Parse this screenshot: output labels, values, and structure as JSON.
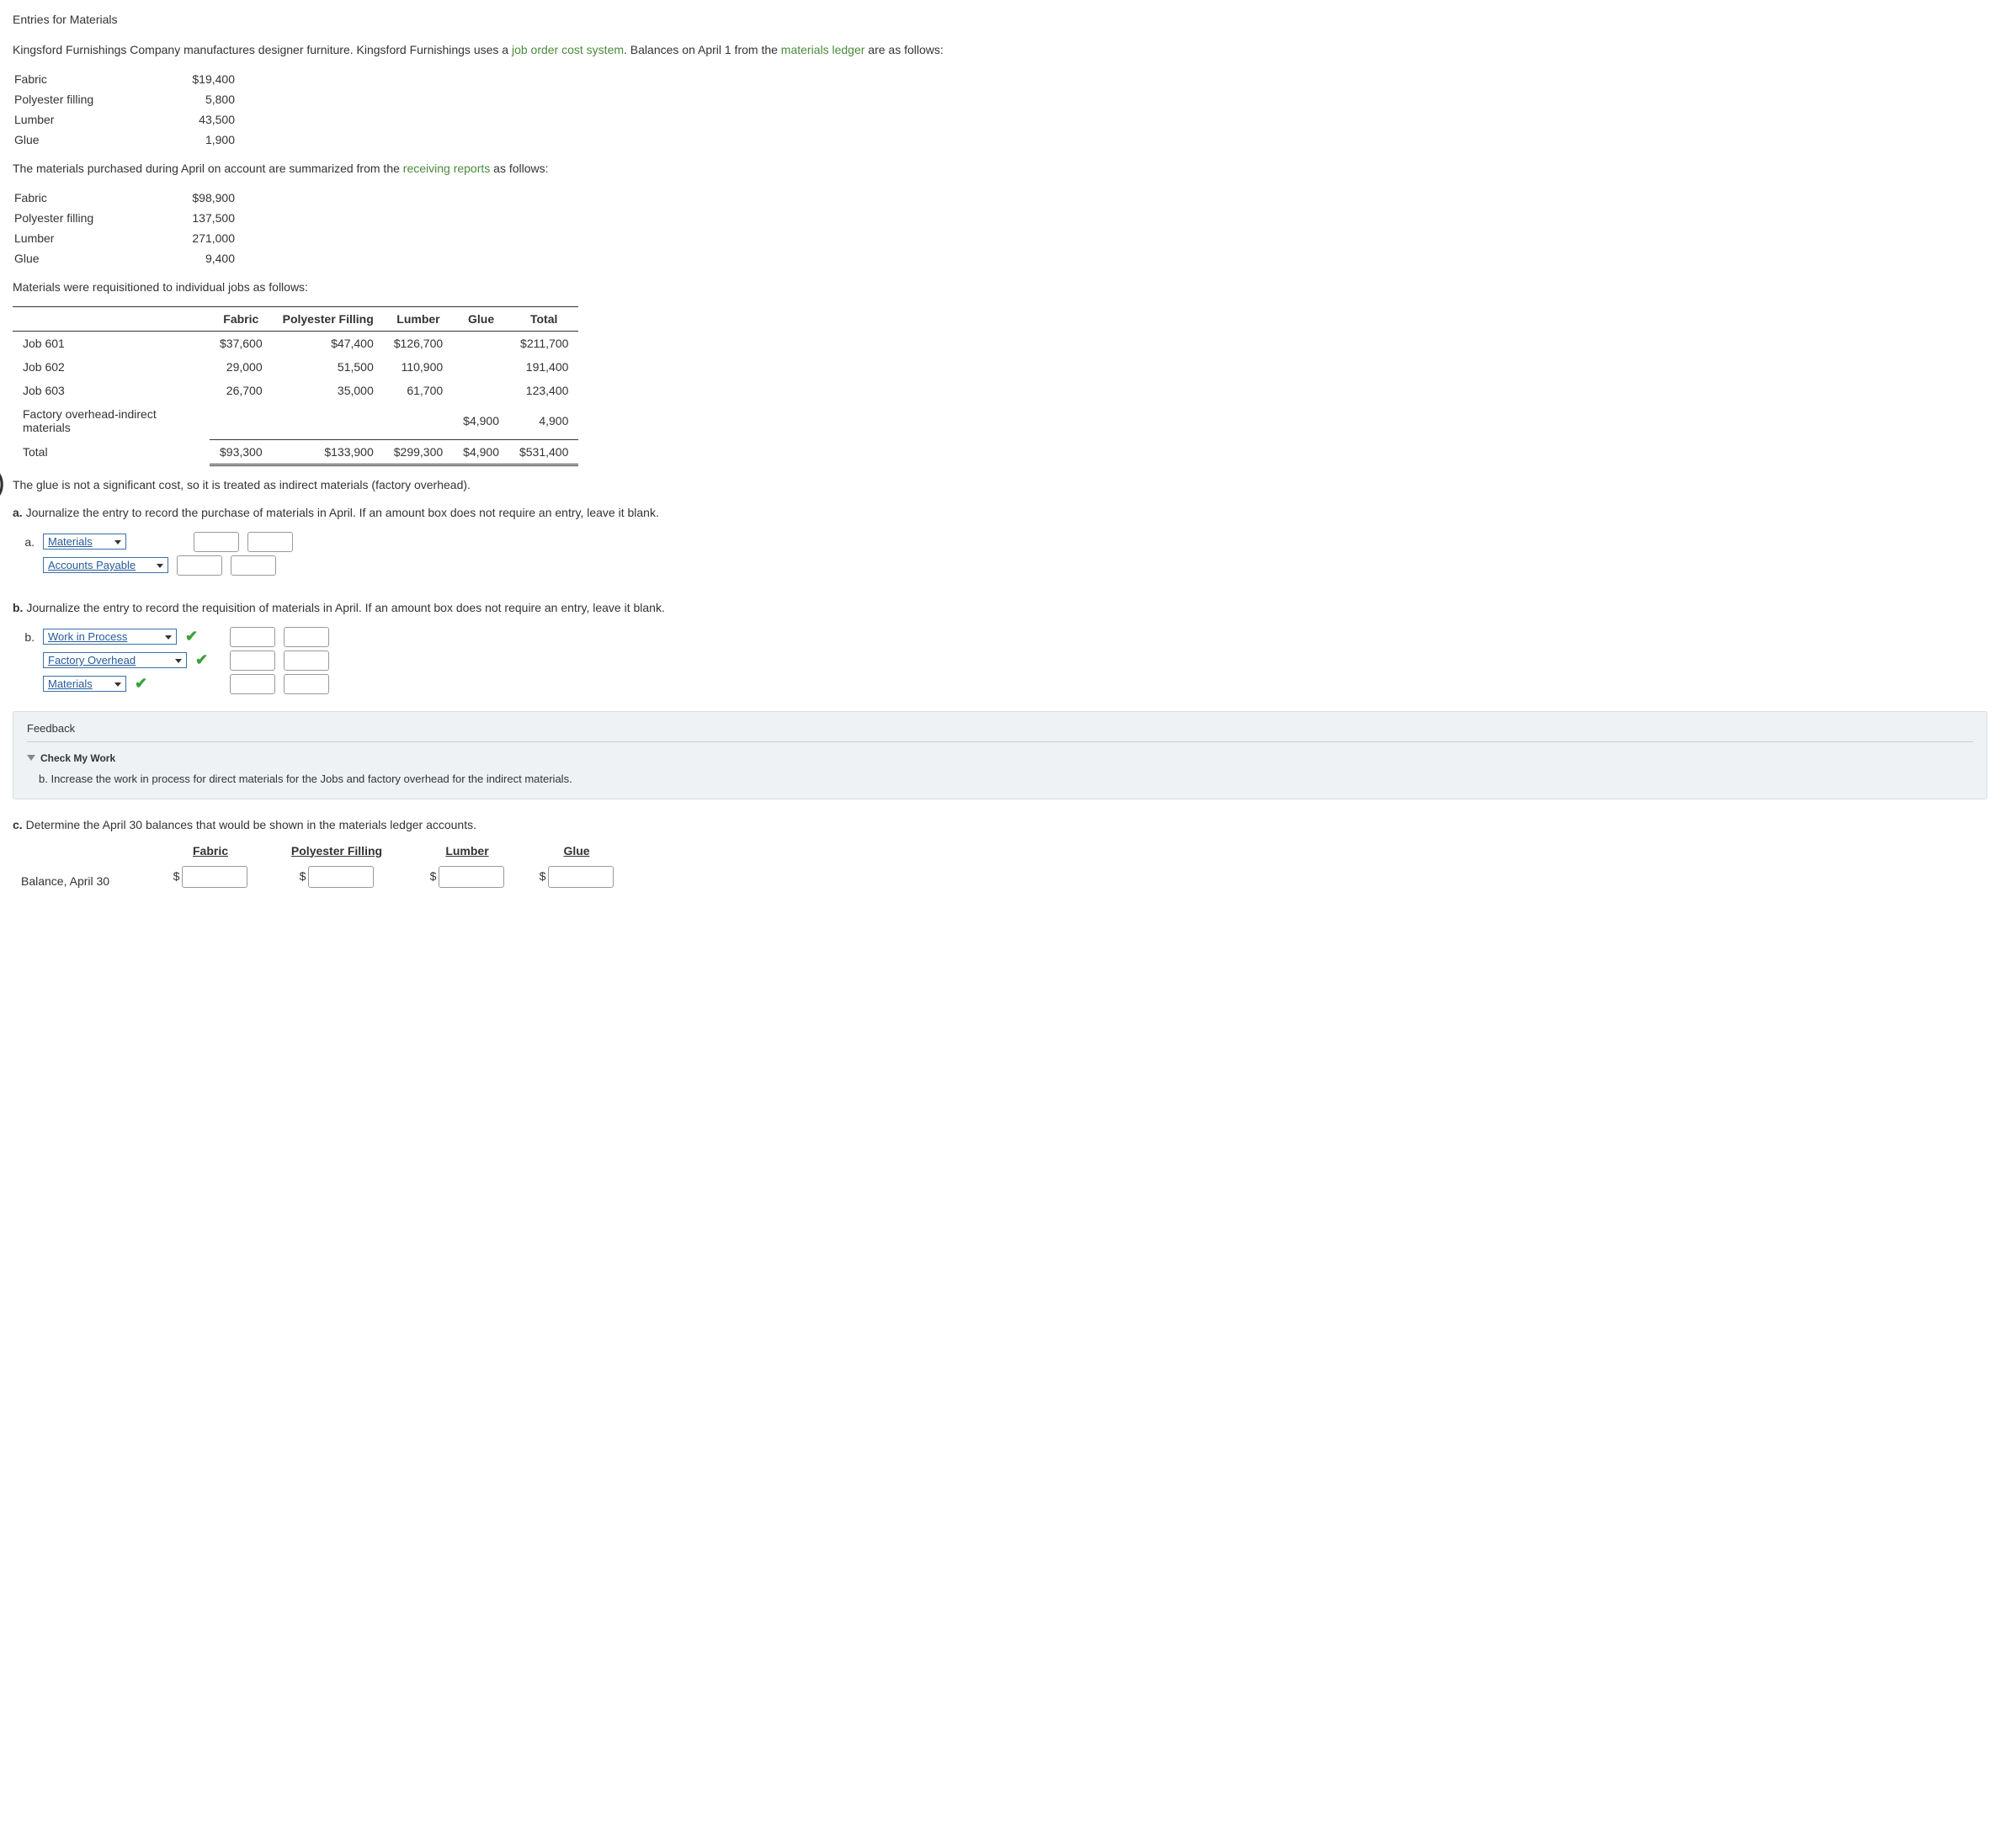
{
  "title": "Entries for Materials",
  "intro_parts": {
    "p1": "Kingsford Furnishings Company manufactures designer furniture. Kingsford Furnishings uses a ",
    "link1": "job order cost system",
    "p2": ". Balances on April 1 from the ",
    "link2": "materials ledger",
    "p3": " are as follows:"
  },
  "balances": [
    {
      "name": "Fabric",
      "value": "$19,400"
    },
    {
      "name": "Polyester filling",
      "value": "5,800"
    },
    {
      "name": "Lumber",
      "value": "43,500"
    },
    {
      "name": "Glue",
      "value": "1,900"
    }
  ],
  "purchases_text_parts": {
    "p1": "The materials purchased during April on account are summarized from the ",
    "link": "receiving reports",
    "p2": " as follows:"
  },
  "purchases": [
    {
      "name": "Fabric",
      "value": "$98,900"
    },
    {
      "name": "Polyester filling",
      "value": "137,500"
    },
    {
      "name": "Lumber",
      "value": "271,000"
    },
    {
      "name": "Glue",
      "value": "9,400"
    }
  ],
  "req_text": "Materials were requisitioned to individual jobs as follows:",
  "req_headers": [
    "",
    "Fabric",
    "Polyester Filling",
    "Lumber",
    "Glue",
    "Total"
  ],
  "req_rows": [
    {
      "label": "Job 601",
      "fabric": "$37,600",
      "poly": "$47,400",
      "lumber": "$126,700",
      "glue": "",
      "total": "$211,700"
    },
    {
      "label": "Job 602",
      "fabric": "29,000",
      "poly": "51,500",
      "lumber": "110,900",
      "glue": "",
      "total": "191,400"
    },
    {
      "label": "Job 603",
      "fabric": "26,700",
      "poly": "35,000",
      "lumber": "61,700",
      "glue": "",
      "total": "123,400"
    },
    {
      "label": "Factory overhead-indirect materials",
      "fabric": "",
      "poly": "",
      "lumber": "",
      "glue": "$4,900",
      "total": "4,900"
    }
  ],
  "req_total": {
    "label": "Total",
    "fabric": "$93,300",
    "poly": "$133,900",
    "lumber": "$299,300",
    "glue": "$4,900",
    "total": "$531,400"
  },
  "glue_note": "The glue is not a significant cost, so it is treated as indirect materials (factory overhead).",
  "qa": {
    "label": "a.",
    "text": "Journalize the entry to record the purchase of materials in April. If an amount box does not require an entry, leave it blank.",
    "sub_label": "a.",
    "line1": "Materials",
    "line2": "Accounts Payable"
  },
  "qb": {
    "label": "b.",
    "text": "Journalize the entry to record the requisition of materials in April. If an amount box does not require an entry, leave it blank.",
    "sub_label": "b.",
    "line1": "Work in Process",
    "line2": "Factory Overhead",
    "line3": "Materials"
  },
  "feedback": {
    "title": "Feedback",
    "check_label": "Check My Work",
    "hint": "b. Increase the work in process for direct materials for the Jobs and factory overhead for the indirect materials."
  },
  "qc": {
    "label": "c.",
    "text": "Determine the April 30 balances that would be shown in the materials ledger accounts.",
    "headers": [
      "Fabric",
      "Polyester Filling",
      "Lumber",
      "Glue"
    ],
    "row_label": "Balance, April 30"
  }
}
